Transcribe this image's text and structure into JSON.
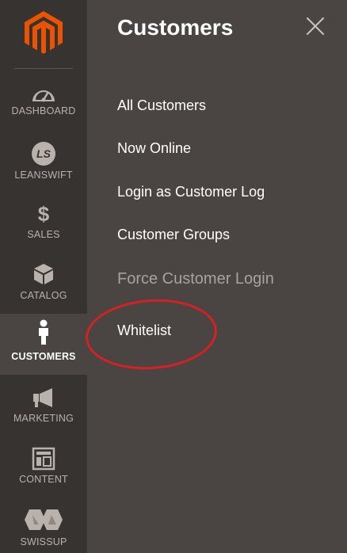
{
  "nav": {
    "items": [
      {
        "label": "DASHBOARD",
        "icon": "dashboard-gauge-icon"
      },
      {
        "label": "LEANSWIFT",
        "icon": "leanswift-ls-icon",
        "icon_text": "LS"
      },
      {
        "label": "SALES",
        "icon": "dollar-icon",
        "icon_text": "$"
      },
      {
        "label": "CATALOG",
        "icon": "box-icon"
      },
      {
        "label": "CUSTOMERS",
        "icon": "person-icon",
        "active": true
      },
      {
        "label": "MARKETING",
        "icon": "megaphone-icon"
      },
      {
        "label": "CONTENT",
        "icon": "layout-icon"
      },
      {
        "label": "SWISSUP",
        "icon": "swissup-icon"
      }
    ]
  },
  "panel": {
    "title": "Customers",
    "items": [
      {
        "label": "All Customers"
      },
      {
        "label": "Now Online"
      },
      {
        "label": "Login as Customer Log"
      },
      {
        "label": "Customer Groups"
      },
      {
        "label": "Force Customer Login",
        "muted": true
      },
      {
        "label": "Whitelist",
        "highlighted": true
      }
    ]
  },
  "colors": {
    "rail": "#373330",
    "panel": "#4a4542",
    "brand_orange": "#eb5202",
    "highlight_circle": "#d62024"
  }
}
